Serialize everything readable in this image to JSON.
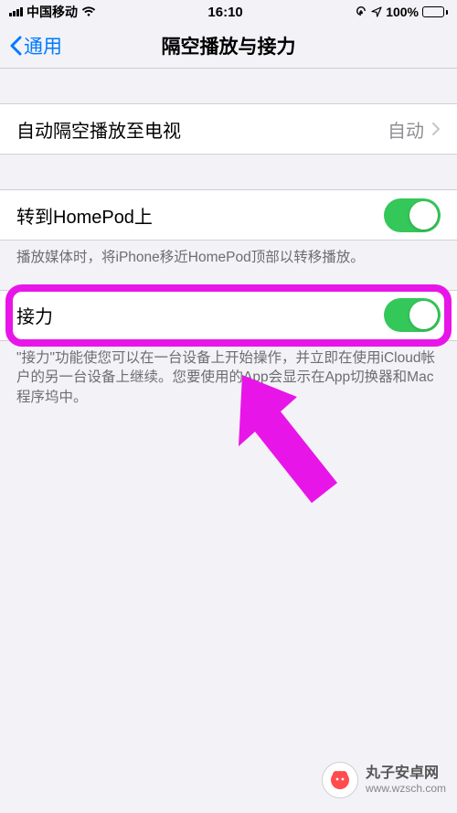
{
  "statusBar": {
    "carrier": "中国移动",
    "time": "16:10",
    "batteryText": "100%"
  },
  "nav": {
    "back": "通用",
    "title": "隔空播放与接力"
  },
  "rows": {
    "airplay": {
      "label": "自动隔空播放至电视",
      "value": "自动"
    },
    "homepod": {
      "label": "转到HomePod上",
      "footer": "播放媒体时，将iPhone移近HomePod顶部以转移播放。"
    },
    "handoff": {
      "label": "接力",
      "footer": "\"接力\"功能使您可以在一台设备上开始操作，并立即在使用iCloud帐户的另一台设备上继续。您要使用的App会显示在App切换器和Mac程序坞中。"
    }
  },
  "watermark": {
    "name": "丸子安卓网",
    "url": "www.wzsch.com"
  },
  "annotation": {
    "highlightColor": "#e815e8"
  }
}
